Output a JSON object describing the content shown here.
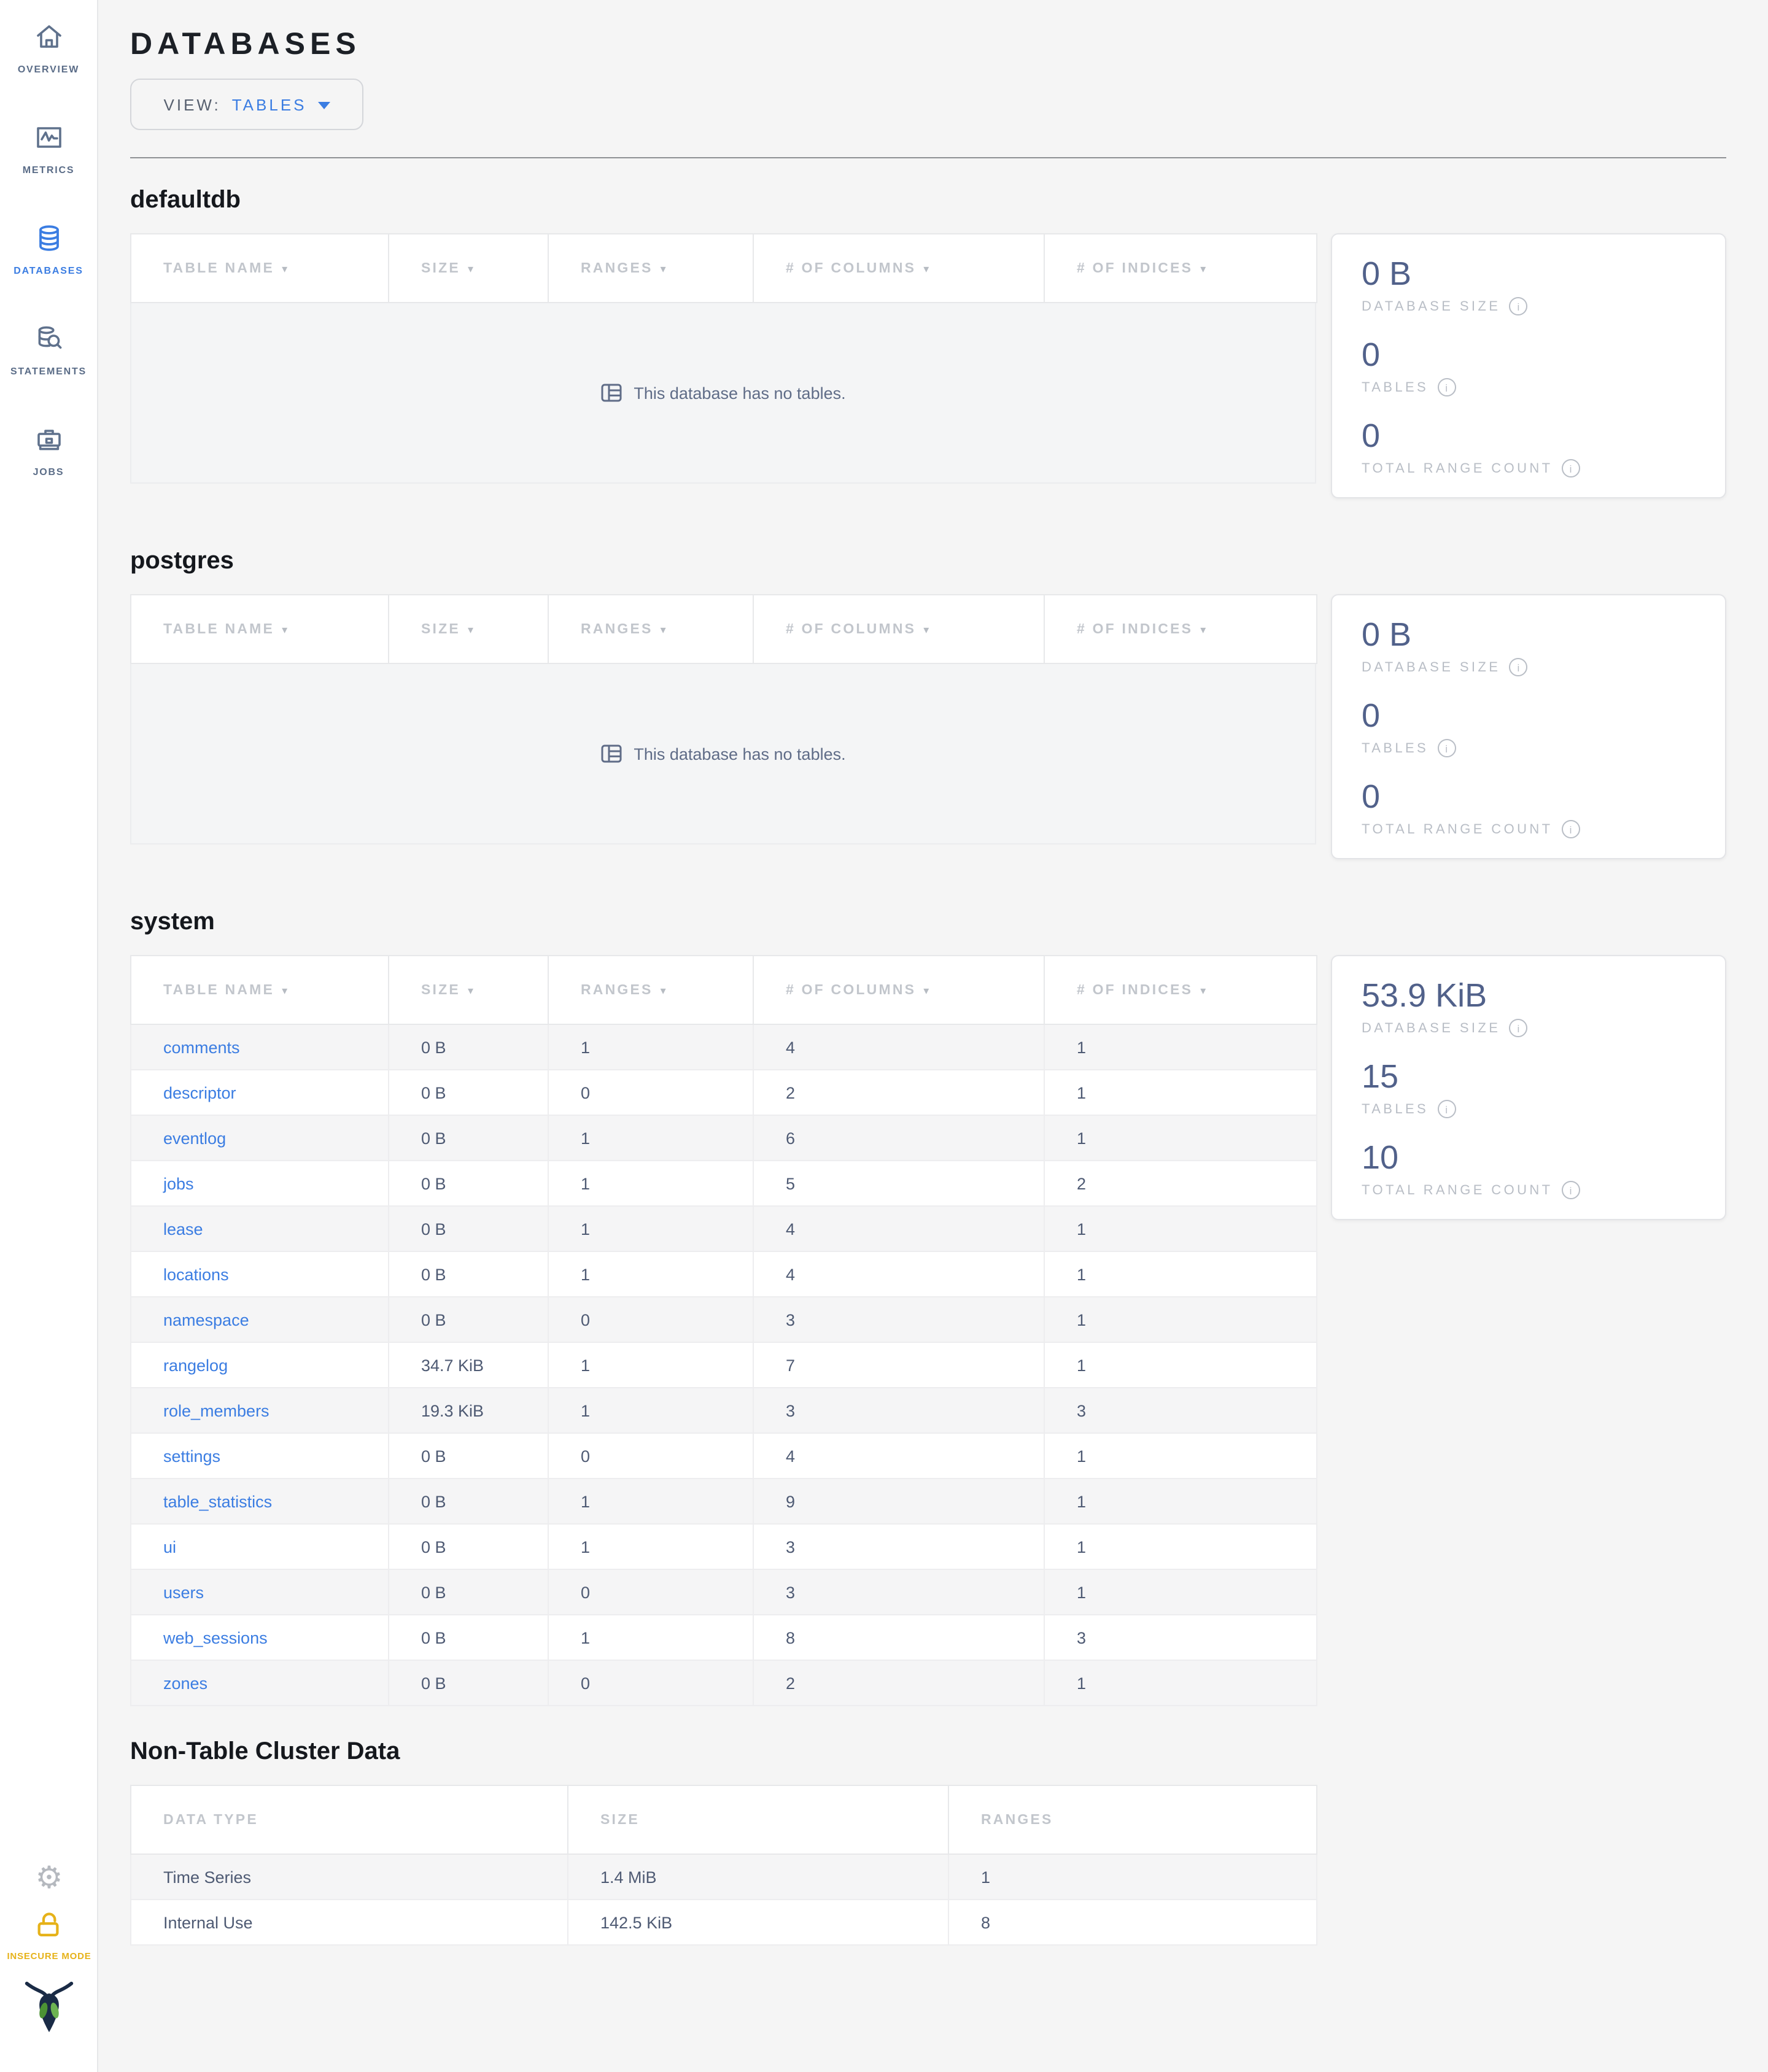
{
  "colors": {
    "accent_blue": "#3b7de2",
    "warning_yellow": "#e6b219",
    "stat_value": "#51618a",
    "page_background": "#f5f5f5"
  },
  "sidebar": {
    "items": [
      {
        "id": "overview",
        "label": "OVERVIEW",
        "icon": "house-icon",
        "active": false
      },
      {
        "id": "metrics",
        "label": "METRICS",
        "icon": "metrics-graph-icon",
        "active": false
      },
      {
        "id": "databases",
        "label": "DATABASES",
        "icon": "database-icon",
        "active": true
      },
      {
        "id": "statements",
        "label": "STATEMENTS",
        "icon": "database-search-icon",
        "active": false
      },
      {
        "id": "jobs",
        "label": "JOBS",
        "icon": "briefcase-icon",
        "active": false
      }
    ],
    "insecure_mode_label": "INSECURE MODE"
  },
  "header": {
    "title": "DATABASES",
    "view_label": "VIEW:",
    "view_value": "TABLES"
  },
  "table_columns": [
    "TABLE NAME",
    "SIZE",
    "RANGES",
    "# OF COLUMNS",
    "# OF INDICES"
  ],
  "empty_message": "This database has no tables.",
  "stat_defs": [
    {
      "key": "size",
      "label": "DATABASE SIZE",
      "name": "database-size"
    },
    {
      "key": "tables",
      "label": "TABLES",
      "name": "tables-count"
    },
    {
      "key": "range_count",
      "label": "TOTAL RANGE COUNT",
      "name": "total-range-count"
    }
  ],
  "databases": [
    {
      "name": "defaultdb",
      "empty": true,
      "stats": {
        "size": "0 B",
        "tables": "0",
        "range_count": "0"
      }
    },
    {
      "name": "postgres",
      "empty": true,
      "stats": {
        "size": "0 B",
        "tables": "0",
        "range_count": "0"
      }
    },
    {
      "name": "system",
      "empty": false,
      "stats": {
        "size": "53.9 KiB",
        "tables": "15",
        "range_count": "10"
      },
      "rows": [
        {
          "name": "comments",
          "size": "0 B",
          "ranges": "1",
          "columns": "4",
          "indices": "1"
        },
        {
          "name": "descriptor",
          "size": "0 B",
          "ranges": "0",
          "columns": "2",
          "indices": "1"
        },
        {
          "name": "eventlog",
          "size": "0 B",
          "ranges": "1",
          "columns": "6",
          "indices": "1"
        },
        {
          "name": "jobs",
          "size": "0 B",
          "ranges": "1",
          "columns": "5",
          "indices": "2"
        },
        {
          "name": "lease",
          "size": "0 B",
          "ranges": "1",
          "columns": "4",
          "indices": "1"
        },
        {
          "name": "locations",
          "size": "0 B",
          "ranges": "1",
          "columns": "4",
          "indices": "1"
        },
        {
          "name": "namespace",
          "size": "0 B",
          "ranges": "0",
          "columns": "3",
          "indices": "1"
        },
        {
          "name": "rangelog",
          "size": "34.7 KiB",
          "ranges": "1",
          "columns": "7",
          "indices": "1"
        },
        {
          "name": "role_members",
          "size": "19.3 KiB",
          "ranges": "1",
          "columns": "3",
          "indices": "3"
        },
        {
          "name": "settings",
          "size": "0 B",
          "ranges": "0",
          "columns": "4",
          "indices": "1"
        },
        {
          "name": "table_statistics",
          "size": "0 B",
          "ranges": "1",
          "columns": "9",
          "indices": "1"
        },
        {
          "name": "ui",
          "size": "0 B",
          "ranges": "1",
          "columns": "3",
          "indices": "1"
        },
        {
          "name": "users",
          "size": "0 B",
          "ranges": "0",
          "columns": "3",
          "indices": "1"
        },
        {
          "name": "web_sessions",
          "size": "0 B",
          "ranges": "1",
          "columns": "8",
          "indices": "3"
        },
        {
          "name": "zones",
          "size": "0 B",
          "ranges": "0",
          "columns": "2",
          "indices": "1"
        }
      ]
    }
  ],
  "non_table": {
    "title": "Non-Table Cluster Data",
    "columns": [
      "DATA TYPE",
      "SIZE",
      "RANGES"
    ],
    "rows": [
      {
        "data_type": "Time Series",
        "size": "1.4 MiB",
        "ranges": "1"
      },
      {
        "data_type": "Internal Use",
        "size": "142.5 KiB",
        "ranges": "8"
      }
    ]
  }
}
